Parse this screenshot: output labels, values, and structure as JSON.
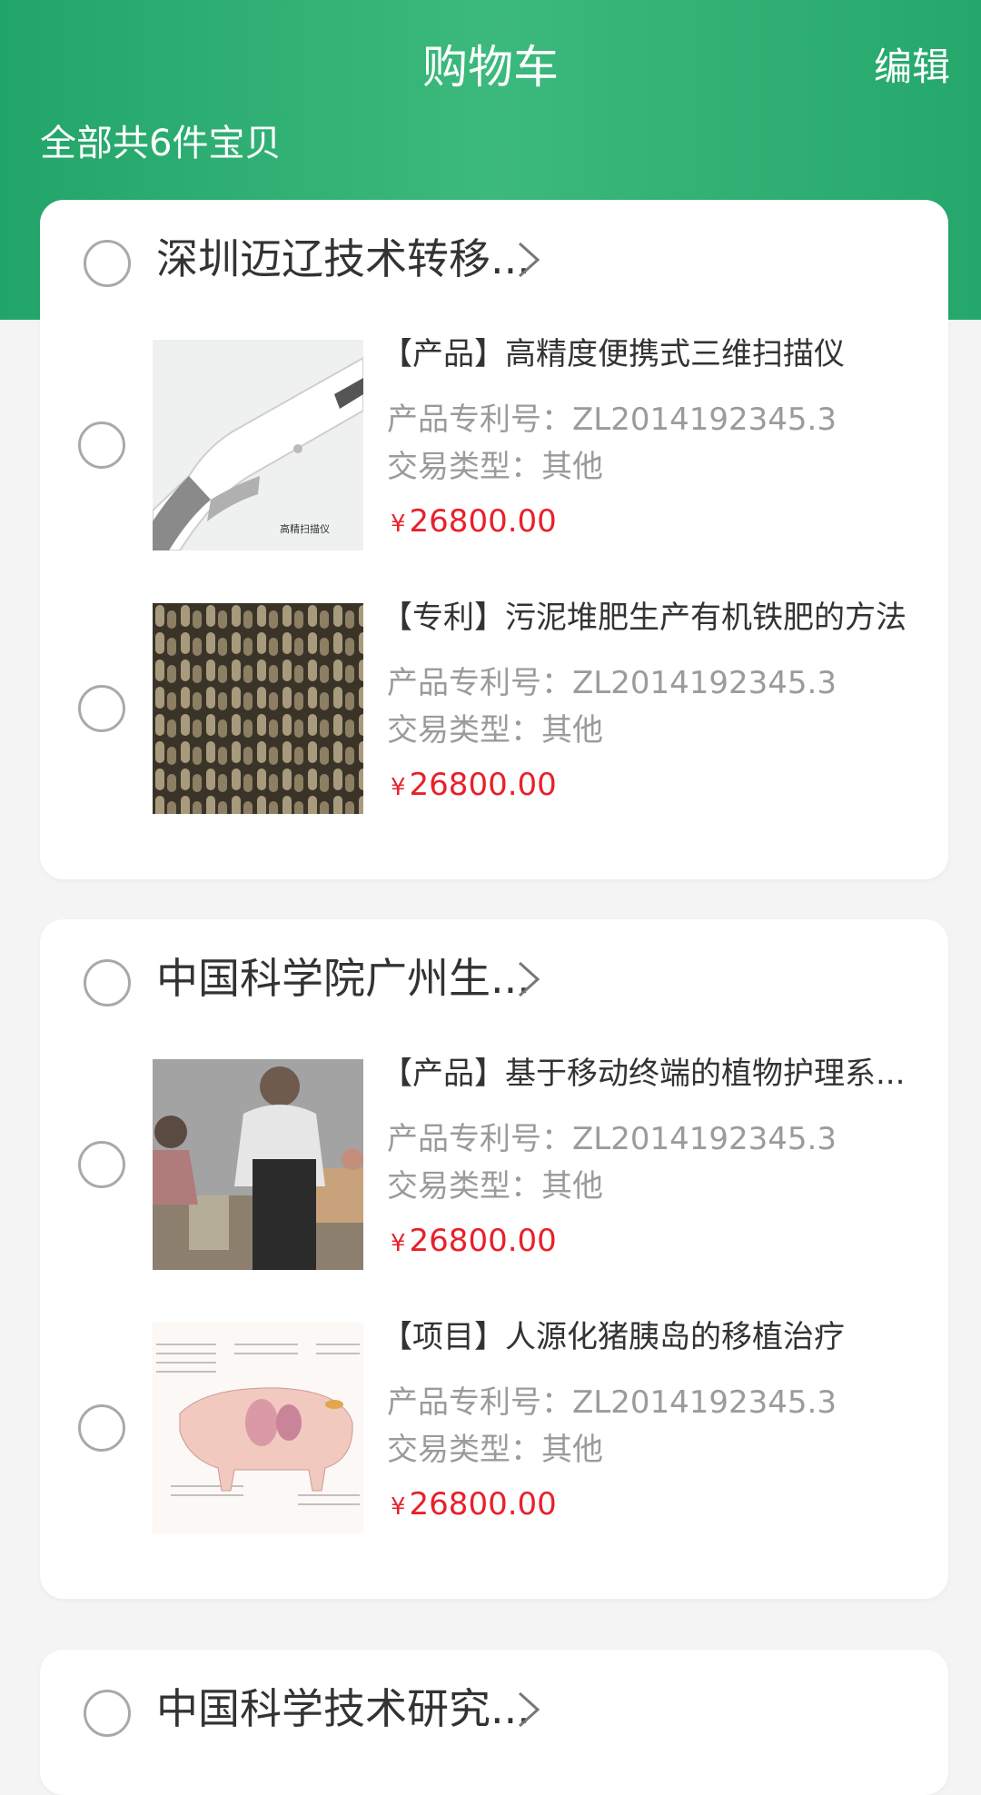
{
  "header": {
    "title": "购物车",
    "edit_label": "编辑",
    "count_text": "全部共6件宝贝",
    "accent": "#2bab6f"
  },
  "shops": [
    {
      "name": "深圳迈辽技术转移...",
      "items": [
        {
          "title": "【产品】高精度便携式三维扫描仪",
          "patent": "产品专利号：ZL2014192345.3",
          "trade": "交易类型：其他",
          "currency": "¥",
          "price": "26800.00",
          "thumb_icon": "handheld-3d-scanner-image",
          "thumb_caption": "高精扫描仪"
        },
        {
          "title": "【专利】污泥堆肥生产有机铁肥的方法",
          "patent": "产品专利号：ZL2014192345.3",
          "trade": "交易类型：其他",
          "currency": "¥",
          "price": "26800.00",
          "thumb_icon": "fertilizer-pellets-image"
        }
      ]
    },
    {
      "name": "中国科学院广州生...",
      "items": [
        {
          "title": "【产品】基于移动终端的植物护理系...",
          "patent": "产品专利号：ZL2014192345.3",
          "trade": "交易类型：其他",
          "currency": "¥",
          "price": "26800.00",
          "thumb_icon": "people-photo-image"
        },
        {
          "title": "【项目】人源化猪胰岛的移植治疗",
          "patent": "产品专利号：ZL2014192345.3",
          "trade": "交易类型：其他",
          "currency": "¥",
          "price": "26800.00",
          "thumb_icon": "pig-diagram-image"
        }
      ]
    },
    {
      "name": "中国科学技术研究..."
    }
  ]
}
